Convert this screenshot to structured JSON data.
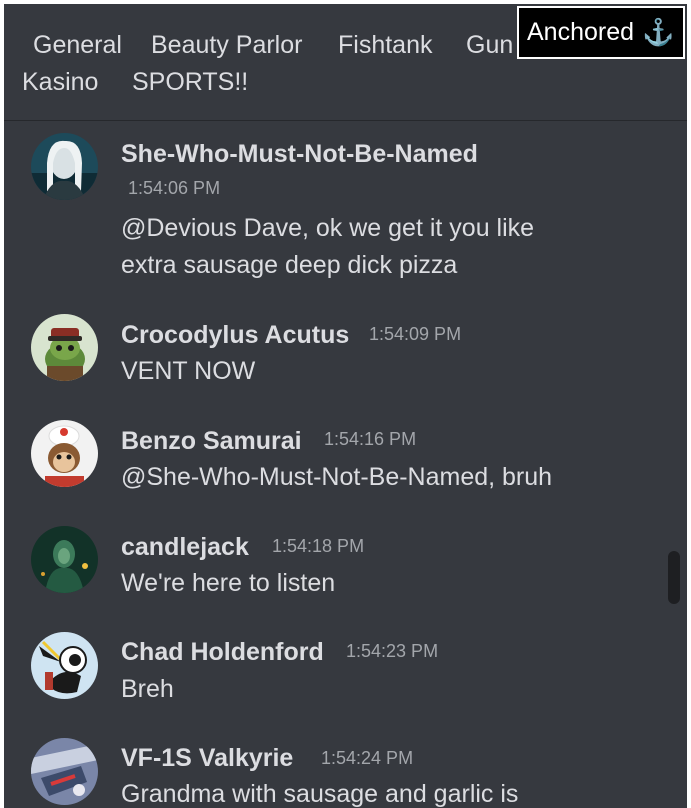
{
  "channels": [
    "General",
    "Beauty Parlor",
    "Fishtank",
    "Gun",
    "Kasino",
    "SPORTS!!"
  ],
  "anchored": {
    "label": "Anchored",
    "icon": "⚓"
  },
  "messages": [
    {
      "user": "She-Who-Must-Not-Be-Named",
      "time": "1:54:06 PM",
      "lines": [
        "@Devious Dave, ok we get it you like",
        "extra sausage deep dick pizza"
      ],
      "avatar_icon": "woman-portrait-icon"
    },
    {
      "user": "Crocodylus Acutus",
      "time": "1:54:09 PM",
      "lines": [
        "VENT NOW"
      ],
      "avatar_icon": "crocodile-officer-icon"
    },
    {
      "user": "Benzo Samurai",
      "time": "1:54:16 PM",
      "lines": [
        "@She-Who-Must-Not-Be-Named, bruh"
      ],
      "avatar_icon": "monkey-chef-icon"
    },
    {
      "user": "candlejack",
      "time": "1:54:18 PM",
      "lines": [
        "We're here to listen"
      ],
      "avatar_icon": "green-figure-icon"
    },
    {
      "user": "Chad Holdenford",
      "time": "1:54:23 PM",
      "lines": [
        "Breh"
      ],
      "avatar_icon": "cartoon-bird-icon"
    },
    {
      "user": "VF-1S Valkyrie",
      "time": "1:54:24 PM",
      "lines": [
        "Grandma with sausage and garlic is"
      ],
      "avatar_icon": "robot-mecha-icon"
    }
  ],
  "colors": {
    "background": "#36393f",
    "text": "#dcdde1",
    "timestamp": "#a3a6ab",
    "anchored_bg": "#000000"
  }
}
